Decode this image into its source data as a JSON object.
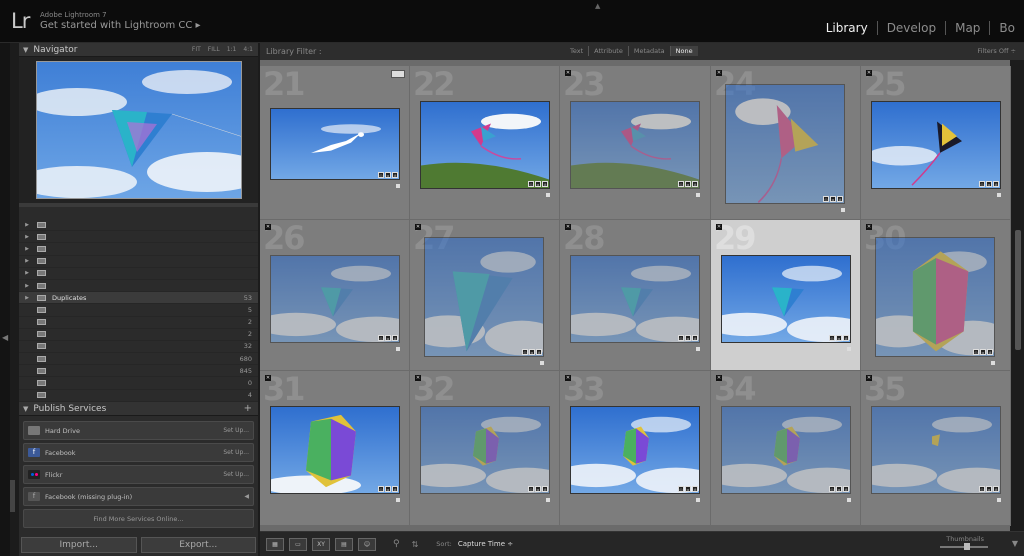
{
  "app": {
    "logo": "Lr",
    "product": "Adobe Lightroom 7",
    "get_started": "Get started with Lightroom CC ▸"
  },
  "modules": [
    "Library",
    "Develop",
    "Map",
    "Bo"
  ],
  "active_module": "Library",
  "navigator": {
    "title": "Navigator",
    "zoom_options": [
      "FIT",
      "FILL",
      "1:1",
      "4:1"
    ]
  },
  "collections": [
    {
      "label": "",
      "count": ""
    },
    {
      "label": "",
      "count": ""
    },
    {
      "label": "",
      "count": ""
    },
    {
      "label": "",
      "count": ""
    },
    {
      "label": "",
      "count": ""
    },
    {
      "label": "",
      "count": ""
    },
    {
      "label": "Duplicates",
      "count": "53",
      "selected": true
    },
    {
      "label": "",
      "count": "5"
    },
    {
      "label": "",
      "count": "2"
    },
    {
      "label": "",
      "count": "2"
    },
    {
      "label": "",
      "count": "32"
    },
    {
      "label": "",
      "count": "680"
    },
    {
      "label": "",
      "count": "845"
    },
    {
      "label": "",
      "count": "0"
    },
    {
      "label": "",
      "count": "4"
    }
  ],
  "publish": {
    "title": "Publish Services",
    "plus": "+",
    "services": [
      {
        "label": "Hard Drive",
        "action": "Set Up...",
        "icon": "hard-drive-icon",
        "color": "#777777"
      },
      {
        "label": "Facebook",
        "action": "Set Up...",
        "icon": "facebook-icon",
        "color": "#3b5998"
      },
      {
        "label": "Flickr",
        "action": "Set Up...",
        "icon": "flickr-icon",
        "color": "#222222"
      },
      {
        "label": "Facebook (missing plug-in)",
        "action": "◀",
        "icon": "facebook-missing-icon",
        "color": "#555555"
      }
    ],
    "find_more": "Find More Services Online..."
  },
  "buttons": {
    "import": "Import...",
    "export": "Export..."
  },
  "filter": {
    "label": "Library Filter :",
    "tabs": [
      "Text",
      "Attribute",
      "Metadata",
      "None"
    ],
    "active_tab": "None",
    "right": "Filters Off ÷"
  },
  "grid": {
    "cells": [
      {
        "num": "21",
        "photo": "gull",
        "dim": false
      },
      {
        "num": "22",
        "photo": "dragon-hill",
        "dim": false
      },
      {
        "num": "23",
        "photo": "dragon-hill",
        "dim": true
      },
      {
        "num": "24",
        "photo": "dragon-tall",
        "dim": true
      },
      {
        "num": "25",
        "photo": "dragon",
        "dim": false
      },
      {
        "num": "26",
        "photo": "blue-kite",
        "dim": true
      },
      {
        "num": "27",
        "photo": "blue-kite-big",
        "dim": true
      },
      {
        "num": "28",
        "photo": "blue-kite",
        "dim": true
      },
      {
        "num": "29",
        "photo": "blue-kite",
        "dim": false,
        "selected": true
      },
      {
        "num": "30",
        "photo": "box-kite-tall",
        "dim": true
      },
      {
        "num": "31",
        "photo": "box-kite",
        "dim": false
      },
      {
        "num": "32",
        "photo": "box-kite-small",
        "dim": true
      },
      {
        "num": "33",
        "photo": "box-kite-small",
        "dim": false
      },
      {
        "num": "34",
        "photo": "box-kite-small",
        "dim": true
      },
      {
        "num": "35",
        "photo": "tiny-kite",
        "dim": true
      }
    ]
  },
  "toolbar": {
    "sort_label": "Sort:",
    "sort_value": "Capture Time ÷",
    "thumbnails_label": "Thumbnails",
    "view_buttons": [
      "grid-view",
      "loupe-view",
      "compare-view",
      "survey-view",
      "people-view"
    ]
  }
}
